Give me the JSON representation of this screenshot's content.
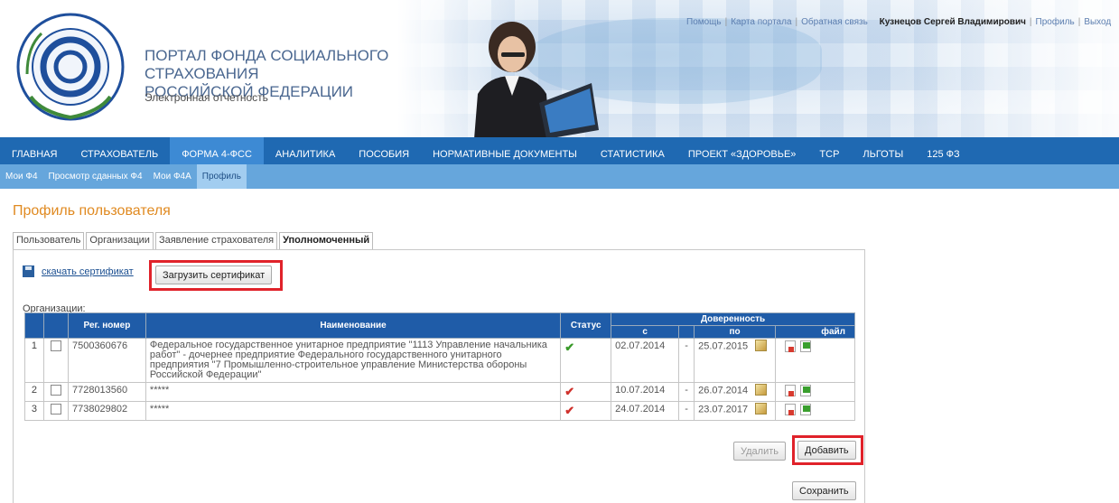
{
  "header": {
    "title_line1": "ПОРТАЛ ФОНДА СОЦИАЛЬНОГО СТРАХОВАНИЯ",
    "title_line2": "РОССИЙСКОЙ ФЕДЕРАЦИИ",
    "subtitle": "Электронная отчетность",
    "links": [
      "Помощь",
      "Карта портала",
      "Обратная связь"
    ],
    "user_name": "Кузнецов Сергей Владимирович",
    "user_links": [
      "Профиль",
      "Выход"
    ]
  },
  "main_nav": [
    "ГЛАВНАЯ",
    "СТРАХОВАТЕЛЬ",
    "ФОРМА 4-ФСС",
    "АНАЛИТИКА",
    "ПОСОБИЯ",
    "НОРМАТИВНЫЕ ДОКУМЕНТЫ",
    "СТАТИСТИКА",
    "ПРОЕКТ «ЗДОРОВЬЕ»",
    "ТСР",
    "ЛЬГОТЫ",
    "125 ФЗ"
  ],
  "sub_nav": [
    "Мои Ф4",
    "Просмотр сданных Ф4",
    "Мои Ф4А",
    "Профиль"
  ],
  "page_title": "Профиль пользователя",
  "tabs": [
    "Пользователь",
    "Организации",
    "Заявление страхователя",
    "Уполномоченный"
  ],
  "panel": {
    "download_link": "скачать сертификат",
    "upload_button": "Загрузить сертификат",
    "orgs_label": "Организации:",
    "columns": {
      "reg_number": "Рег. номер",
      "name": "Наименование",
      "status": "Статус",
      "proxy": "Доверенность",
      "from": "с",
      "to": "по",
      "file": "файл"
    },
    "rows": [
      {
        "n": "1",
        "reg": "7500360676",
        "name": "Федеральное государственное унитарное предприятие \"1113 Управление начальника работ\" - дочернее предприятие Федерального государственного унитарного предприятия \"7 Промышленно-строительное управление Министерства обороны Российской Федерации\"",
        "status": "✔",
        "from": "02.07.2014",
        "dash": "-",
        "to": "25.07.2015"
      },
      {
        "n": "2",
        "reg": "7728013560",
        "name": "*****",
        "status": "✔",
        "from": "10.07.2014",
        "dash": "-",
        "to": "26.07.2014"
      },
      {
        "n": "3",
        "reg": "7738029802",
        "name": "*****",
        "status": "✔",
        "from": "24.07.2014",
        "dash": "-",
        "to": "23.07.2017"
      }
    ],
    "delete_button": "Удалить",
    "add_button": "Добавить",
    "save_button": "Сохранить"
  },
  "colors": {
    "nav": "#1f69b2",
    "subnav": "#66a6dc",
    "accent": "#e08a21",
    "highlight": "#e0222a"
  }
}
